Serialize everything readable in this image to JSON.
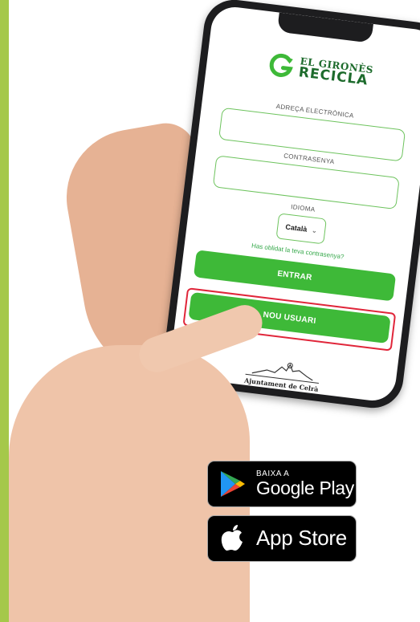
{
  "app": {
    "logo_line1": "EL GIRONÈS",
    "logo_line2": "RECICLA"
  },
  "form": {
    "email_label": "ADREÇA ELECTRÒNICA",
    "password_label": "CONTRASENYA",
    "language_label": "IDIOMA",
    "language_selected": "Català",
    "forgot_link": "Has oblidat la teva contrasenya?",
    "login_button": "ENTRAR",
    "register_button": "NOU USUARI"
  },
  "footer": {
    "ajuntament": "Ajuntament de Celrà"
  },
  "stores": {
    "google_small": "BAIXA A",
    "google_big": "Google Play",
    "apple_big": "App Store"
  },
  "colors": {
    "accent_green": "#3eb938",
    "field_border": "#6dc35d",
    "highlight_red": "#e0263a",
    "side_band": "#a5c84a"
  },
  "icons": {
    "logo": "recycle-g-icon",
    "google": "google-play-icon",
    "apple": "apple-icon"
  }
}
